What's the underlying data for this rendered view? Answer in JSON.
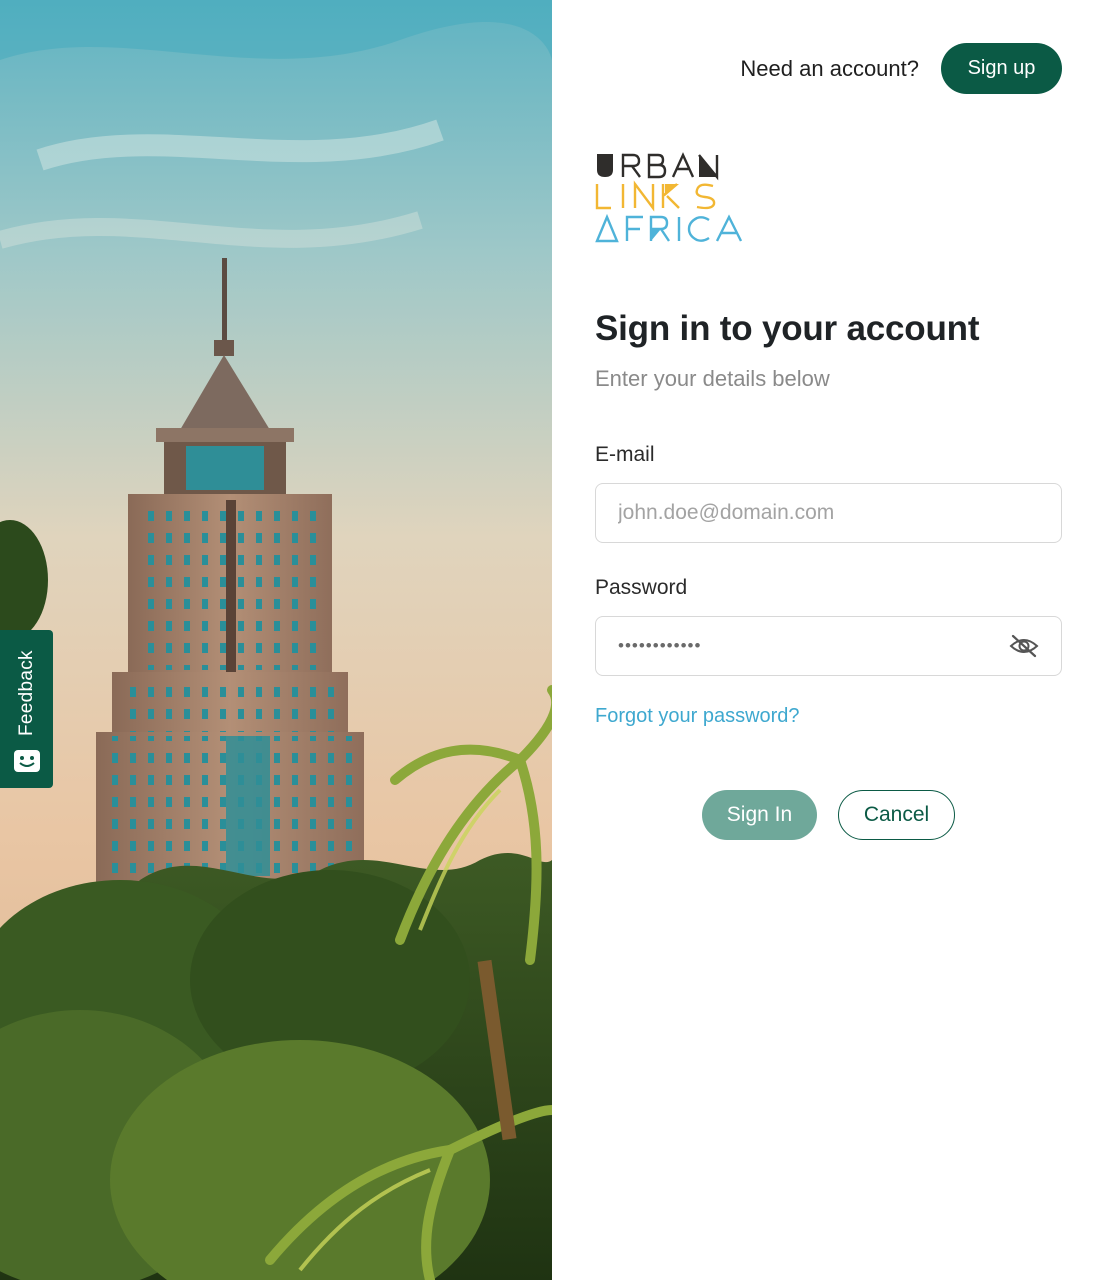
{
  "hero": {
    "image": "tower-and-palms-photo"
  },
  "feedback": {
    "label": "Feedback",
    "icon": "smiley-chat-icon"
  },
  "topbar": {
    "prompt": "Need an account?",
    "signup_label": "Sign up"
  },
  "logo": {
    "line1": "URBAN",
    "line2": "LINKS",
    "line3": "AFRICA"
  },
  "form": {
    "title": "Sign in to your account",
    "subtitle": "Enter your details below",
    "email_label": "E-mail",
    "email_placeholder": "john.doe@domain.com",
    "password_label": "Password",
    "password_value": "••••••••••••",
    "password_icon": "eye-off-icon",
    "forgot_label": "Forgot your password?",
    "signin_label": "Sign In",
    "cancel_label": "Cancel"
  },
  "colors": {
    "brand_green": "#0b5a45",
    "signin_muted": "#6fa89a",
    "link_blue": "#3ea8cf",
    "logo_dark": "#2f2d2b",
    "logo_yellow": "#f2b733",
    "logo_blue": "#4fb3d9"
  }
}
